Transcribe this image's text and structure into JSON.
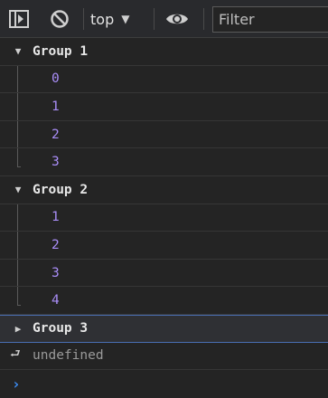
{
  "toolbar": {
    "sidebar_icon": "sidebar-toggle-icon",
    "clear_icon": "block-icon",
    "context_label": "top",
    "context_arrow": "▼",
    "eye_icon": "eye-icon",
    "filter_placeholder": "Filter"
  },
  "console": {
    "groups": [
      {
        "label": "Group 1",
        "expanded": true,
        "items": [
          "0",
          "1",
          "2",
          "3"
        ]
      },
      {
        "label": "Group 2",
        "expanded": true,
        "items": [
          "1",
          "2",
          "3",
          "4"
        ]
      },
      {
        "label": "Group 3",
        "expanded": false,
        "items": []
      }
    ],
    "result_text": "undefined",
    "colors": {
      "value": "#a98df7",
      "prompt": "#3d8df5",
      "selected_border": "#4a6fb5"
    }
  }
}
